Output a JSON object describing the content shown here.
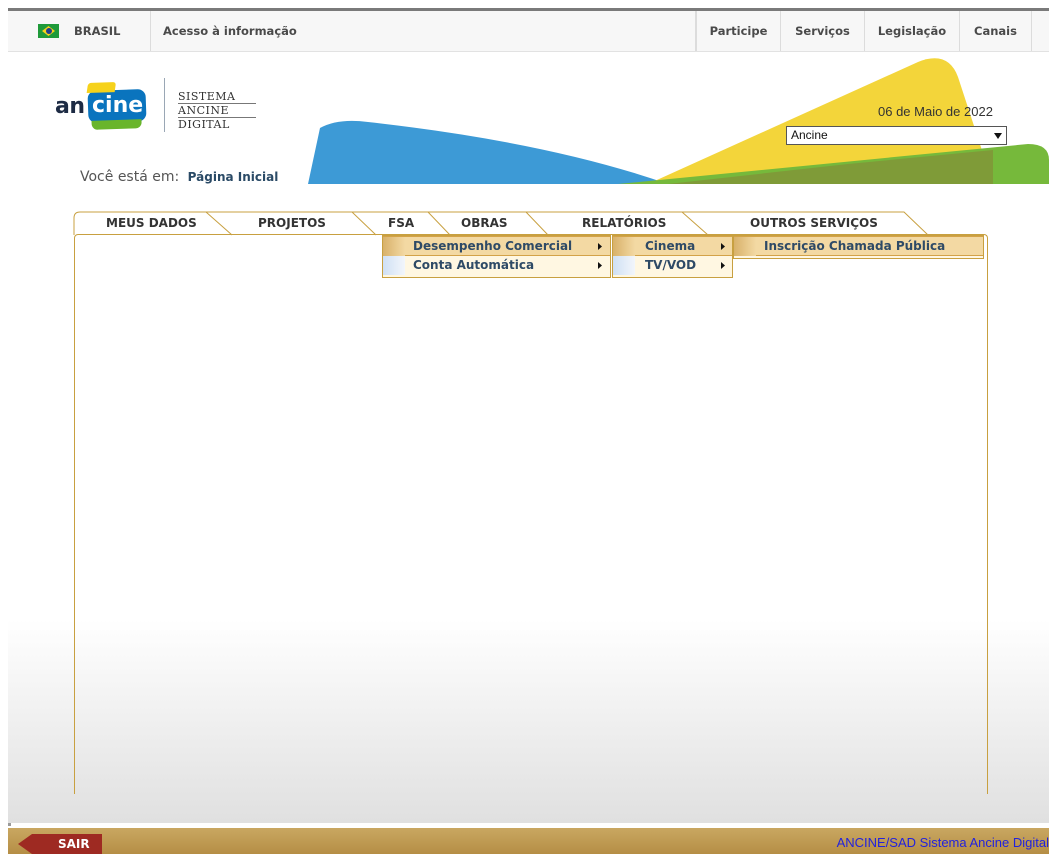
{
  "gov_bar": {
    "country": "BRASIL",
    "acesso": "Acesso à informação",
    "links": [
      "Participe",
      "Serviços",
      "Legislação",
      "Canais"
    ]
  },
  "header": {
    "logo_an": "an",
    "logo_cine": "cine",
    "sistema_lines": [
      "SISTEMA",
      "ANCINE",
      "DIGITAL"
    ],
    "date": "06 de Maio de 2022",
    "org_select_value": "Ancine",
    "breadcrumb_prefix": "Você está em:",
    "breadcrumb_current": "Página Inicial"
  },
  "tabs": [
    "MEUS DADOS",
    "PROJETOS",
    "FSA",
    "OBRAS",
    "RELATÓRIOS",
    "OUTROS SERVIÇOS"
  ],
  "menus": {
    "fsa": [
      "Desempenho Comercial",
      "Conta Automática"
    ],
    "desempenho": [
      "Cinema",
      "TV/VOD"
    ],
    "cinema": [
      "Inscrição Chamada Pública"
    ]
  },
  "footer": {
    "sair": "SAIR",
    "credit": "ANCINE/SAD Sistema Ancine Digital"
  },
  "colors": {
    "ancine_blue": "#3d9ad6",
    "ancine_yellow": "#f3d53a",
    "ancine_green": "#76b93b",
    "tab_border": "#c8a040",
    "menu_active": "#f3d9a3",
    "sair_red": "#9e2a22",
    "footer_gold": "#c9a761"
  },
  "icons": {
    "flag": "brazil-flag-icon",
    "select_caret": "chevron-down-icon",
    "submenu_arrow": "chevron-right-icon"
  }
}
